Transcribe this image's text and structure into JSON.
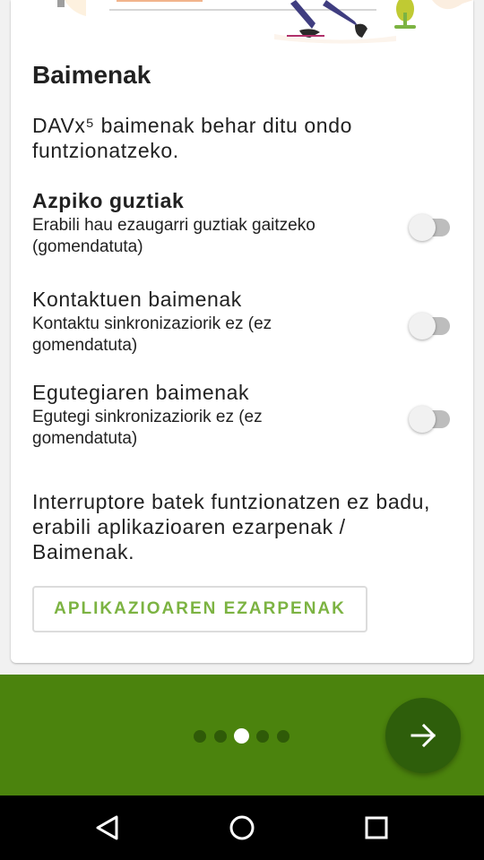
{
  "section": {
    "title": "Baimenak",
    "intro": "DAVx⁵ baimenak behar ditu ondo funtzionatzeko."
  },
  "permissions": [
    {
      "title": "Azpiko guztiak",
      "description": "Erabili hau ezaugarri guztiak gaitzeko (gomendatuta)",
      "enabled": false
    },
    {
      "title": "Kontaktuen baimenak",
      "description": "Kontaktu sinkronizaziorik ez (ez gomendatuta)",
      "enabled": false
    },
    {
      "title": "Egutegiaren baimenak",
      "description": "Egutegi sinkronizaziorik ez (ez gomendatuta)",
      "enabled": false
    }
  ],
  "note": "Interruptore batek funtzionatzen ez badu, erabili aplikazioaren ezarpenak / Baimenak.",
  "settings_button": "APLIKAZIOAREN EZARPENAK",
  "pager": {
    "total": 5,
    "current": 3
  },
  "colors": {
    "primary": "#4b830d",
    "primary_dark": "#2e5e0b",
    "accent": "#7cb342"
  },
  "icons": {
    "next": "arrow-right-icon",
    "back": "triangle-back-icon",
    "home": "circle-home-icon",
    "recents": "square-recents-icon"
  }
}
